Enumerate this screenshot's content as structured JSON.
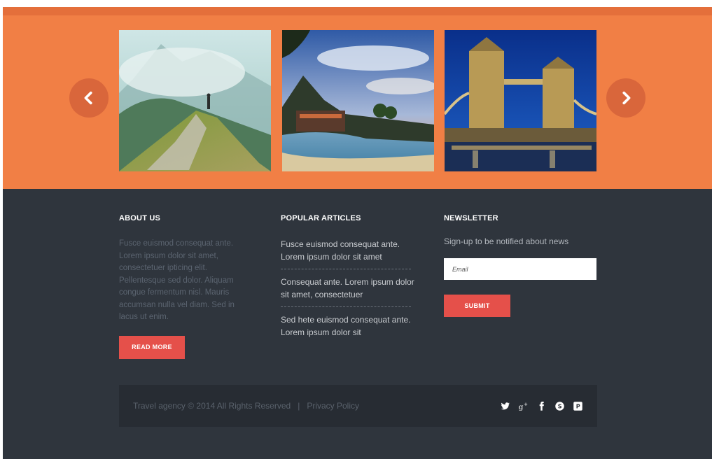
{
  "colors": {
    "accent_orange": "#f17f45",
    "footer_bg": "#2f353d",
    "bottom_bar_bg": "#272c33",
    "button_red": "#e5504a"
  },
  "slider": {
    "prev_icon": "chevron-left-icon",
    "next_icon": "chevron-right-icon",
    "slides": [
      {
        "subject": "mountain-hiker-photo"
      },
      {
        "subject": "tropical-beach-photo"
      },
      {
        "subject": "tower-bridge-photo"
      }
    ]
  },
  "about": {
    "title": "ABOUT US",
    "text": "Fusce euismod consequat ante. Lorem ipsum dolor sit amet, consectetuer ipticing elit. Pellentesque sed dolor. Aliquam congue fermentum nisl. Mauris accumsan nulla vel diam. Sed in lacus ut enim.",
    "button_label": "READ MORE"
  },
  "popular": {
    "title": "POPULAR ARTICLES",
    "articles": [
      {
        "text": "Fusce euismod consequat ante. Lorem ipsum dolor sit amet"
      },
      {
        "text": "Consequat ante. Lorem ipsum dolor sit amet, consectetuer"
      },
      {
        "text": "Sed hete euismod consequat ante. Lorem ipsum dolor sit"
      }
    ]
  },
  "newsletter": {
    "title": "NEWSLETTER",
    "text": "Sign-up to be notified about news",
    "email_placeholder": "Email",
    "submit_label": "SUBMIT"
  },
  "footer": {
    "copyright": "Travel agency © 2014 All Rights Reserved",
    "separator": "|",
    "privacy_link": "Privacy Policy",
    "social_icons": [
      "twitter-icon",
      "google-plus-icon",
      "facebook-icon",
      "skype-icon",
      "pinterest-icon"
    ]
  }
}
